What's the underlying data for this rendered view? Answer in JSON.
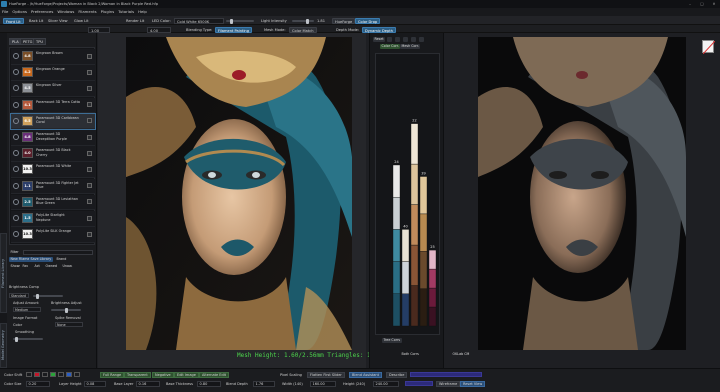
{
  "window": {
    "title": "HueForge - /h/HueForge/Projects/Woman in Black 2/Woman in Black Purple Red.hfp"
  },
  "menu": [
    "File",
    "Options",
    "Preferences",
    "Windows",
    "Filaments",
    "Plugins",
    "Tutorials",
    "Help"
  ],
  "toolbar1": {
    "front_lit": "Front Lit",
    "back_lit": "Back Lit",
    "slicer_view": "Slicer View",
    "glow_lit": "Glow Lit",
    "render_lit": "Render Lit",
    "led_color_label": "LED Color:",
    "led_color_value": "Cold White 6500K",
    "light_intensity": "Light Intensity",
    "light_intensity_value": "1.81",
    "hueforge": "HueForge",
    "color_drop": "Color Drop"
  },
  "toolbar2": {
    "value_a": "1.00",
    "value_b": "4.00",
    "blending_type": "Blending Type:",
    "filament_painting": "Filament Painting",
    "mesh_mode": "Mesh Mode:",
    "color_match": "Color Match",
    "depth_mode": "Depth Mode:",
    "dynamic_depth": "Dynamic Depth"
  },
  "left_vertical_tabs": [
    "Filament Library",
    "Model Geometry"
  ],
  "filament_tabs": [
    "PLA",
    "PETG",
    "TPU"
  ],
  "filaments": [
    {
      "td": "4.8",
      "color": "#7a4f28",
      "name": "Kingroon Brown"
    },
    {
      "td": "4.2",
      "color": "#c96a1f",
      "name": "Kingroon Orange"
    },
    {
      "td": "4.5",
      "color": "#8d9197",
      "name": "Kingroon Silver"
    },
    {
      "td": "4.1",
      "color": "#b55a3d",
      "name": "Paramount 3D Terra Cotta"
    },
    {
      "td": "6.5",
      "color": "#d0a15c",
      "name": "Paramount 3D Caribbean Coral"
    },
    {
      "td": "4.8",
      "color": "#6b2f7a",
      "name": "Paramount 3D Deceptikon Purple"
    },
    {
      "td": "4.0",
      "color": "#5a1f2b",
      "name": "Paramount 3D Black Cherry"
    },
    {
      "td": "10.3",
      "color": "#f1f1f1",
      "name": "Paramount 3D White"
    },
    {
      "td": "1.1",
      "color": "#2c3e6a",
      "name": "Paramount 3D Fighter Jet Blue"
    },
    {
      "td": "2.5",
      "color": "#1f5b6d",
      "name": "Paramount 3D Leviathan Blue Green"
    },
    {
      "td": "1.5",
      "color": "#2c6f8a",
      "name": "PolyLite Starlight Neptune"
    },
    {
      "td": "10.3",
      "color": "#f0f0f0",
      "name": "PolyLite SILK Orange"
    }
  ],
  "filter": {
    "label": "Filter",
    "new_filament": "New Filament",
    "save_library": "Save Library",
    "brand": "Brand",
    "options": [
      "Show:",
      "Fav",
      "Act",
      "Owned",
      "Unow."
    ]
  },
  "geometry": {
    "brightness_comp": "Brightness Comp",
    "standard": "Standard",
    "adjust_amount": "Adjust Amount",
    "brightness_adjust": "Brightness Adjust",
    "medium": "Medium",
    "image_format": "Image Format",
    "spike_removal": "Spike Removal",
    "color": "Color",
    "none": "None",
    "smoothing": "Smoothing"
  },
  "mesh_info": "Mesh Height: 1.60/2.56mm    Triangles: 1920000",
  "middle": {
    "reset": "Reset",
    "color_corr": "Color Corr.",
    "mesh_corr": "Mesh Corr.",
    "tree_corrs": "Tree Corrs",
    "both_corrs": "Both Corrs",
    "oklab_cm": "OKLab CM"
  },
  "bars": [
    {
      "label": "24",
      "top_value": "",
      "fill_ratio": 0.7,
      "colors": [
        "#1d4f63",
        "#2a6e85",
        "#3f8aa0",
        "#c9cfd3",
        "#e9e9e9"
      ]
    },
    {
      "label": "40",
      "top_value": "",
      "fill_ratio": 0.42,
      "colors": [
        "#243d66",
        "#cfd4d9",
        "#e7e0d2"
      ]
    },
    {
      "label": "22",
      "top_value": "",
      "fill_ratio": 0.88,
      "colors": [
        "#4a2a1e",
        "#8a5536",
        "#c08a5b",
        "#dcc39b",
        "#efe6d6"
      ]
    },
    {
      "label": "39",
      "top_value": "",
      "fill_ratio": 0.65,
      "colors": [
        "#2a1d12",
        "#6a4a2c",
        "#b88a50",
        "#e1c79a"
      ]
    },
    {
      "label": "25",
      "top_value": "",
      "fill_ratio": 0.33,
      "colors": [
        "#3a1122",
        "#6b1a3b",
        "#a33a63",
        "#e2b5c7"
      ]
    }
  ],
  "bottom_row1": {
    "color_shift": "Color Shift",
    "full_range": "Full Range",
    "transparent": "Transparent",
    "negative": "Negative",
    "edit_image": "Edit Image",
    "alternate_edit": "Alternate Edit",
    "pixel_scaling": "Pixel Scaling",
    "flatten_first_slider": "Flatten First Slider",
    "blend_assistant": "Blend Assistant",
    "describe": "Describe"
  },
  "bottom_row2": {
    "color_size_label": "Color Size",
    "color_size": "0.20",
    "layer_height_label": "Layer Height",
    "layer_height": "0.08",
    "base_layer_label": "Base Layer",
    "base_layer": "0.16",
    "base_thickness_label": "Base Thickness",
    "base_thickness": "0.80",
    "blend_depth_label": "Blend Depth",
    "blend_depth": "1.76",
    "width_label": "Width (140)",
    "width": "160.00",
    "height_label": "Height (240)",
    "height": "240.00",
    "wireframe": "Wireframe",
    "reset_view": "Reset View"
  }
}
